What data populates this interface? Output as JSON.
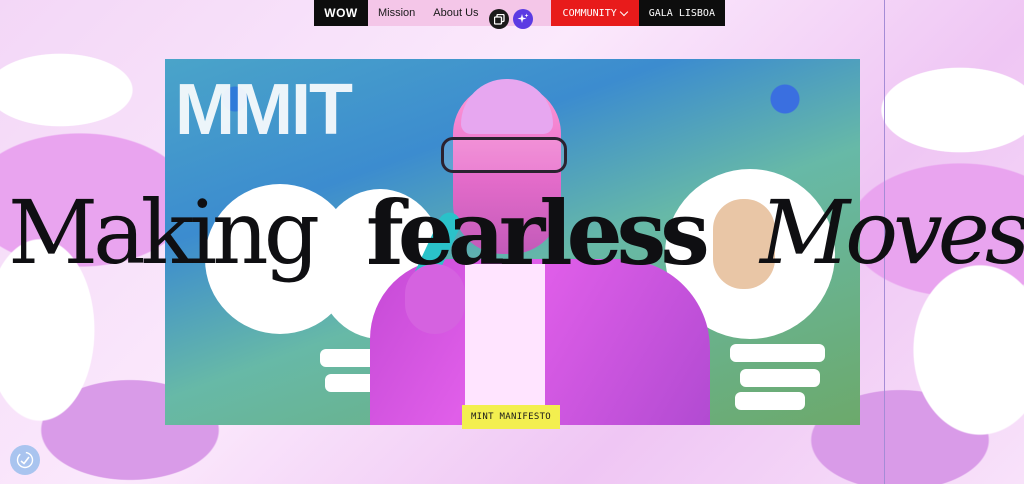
{
  "nav": {
    "logo": "WOW",
    "links": [
      "Mission",
      "About Us"
    ],
    "community_label": "COMMUNITY",
    "gala_label": "GALA LISBOA"
  },
  "hero": {
    "background_text": "MMIT",
    "headline": {
      "word1": "Making",
      "word2": "fearless",
      "word3": "Moves"
    }
  },
  "cta": {
    "manifesto_label": "MINT MANIFESTO"
  },
  "icons": {
    "copy": "copy-icon",
    "ai": "sparkle-icon",
    "accessibility": "accessibility-icon",
    "dropdown": "chevron-down-icon"
  },
  "colors": {
    "community_bg": "#e81b1b",
    "nav_links_bg": "#f4c6e8",
    "cta_bg": "#f3ef4f",
    "ai_button": "#5b3be3"
  }
}
